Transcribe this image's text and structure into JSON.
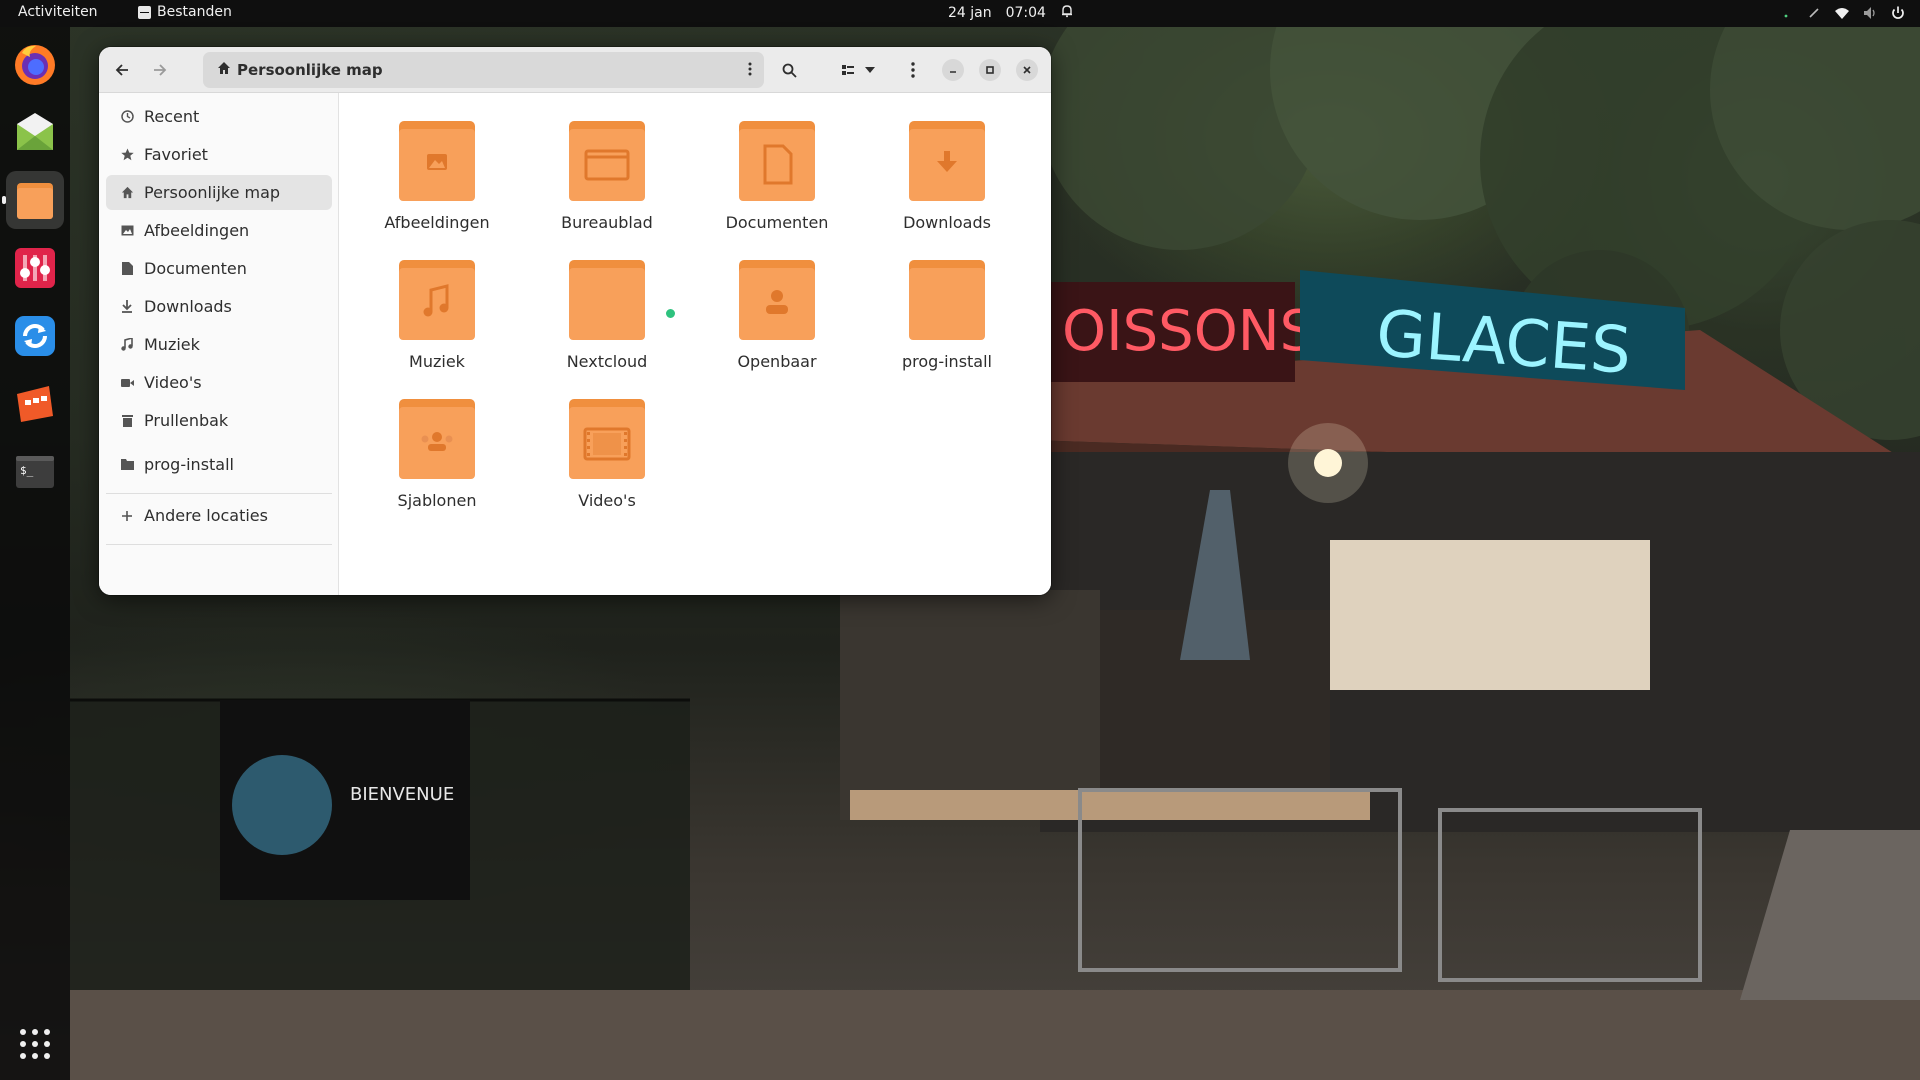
{
  "topbar": {
    "activities": "Activiteiten",
    "app_name": "Bestanden",
    "date": "24 jan",
    "time": "07:04"
  },
  "dock": {
    "items": [
      {
        "name": "firefox",
        "icon": "firefox-icon"
      },
      {
        "name": "mail",
        "icon": "mail-icon"
      },
      {
        "name": "files",
        "icon": "files-icon",
        "active": true
      },
      {
        "name": "mixer",
        "icon": "mixer-icon"
      },
      {
        "name": "sync",
        "icon": "sync-icon"
      },
      {
        "name": "media",
        "icon": "media-app-icon"
      },
      {
        "name": "terminal",
        "icon": "terminal-icon"
      },
      {
        "name": "app-grid",
        "icon": "app-grid-icon"
      }
    ]
  },
  "window": {
    "path": "Persoonlijke map"
  },
  "sidebar": {
    "items": [
      {
        "label": "Recent",
        "icon": "clock-icon"
      },
      {
        "label": "Favoriet",
        "icon": "star-icon"
      },
      {
        "label": "Persoonlijke map",
        "icon": "home-icon",
        "selected": true
      },
      {
        "label": "Afbeeldingen",
        "icon": "image-icon"
      },
      {
        "label": "Documenten",
        "icon": "document-icon"
      },
      {
        "label": "Downloads",
        "icon": "download-icon"
      },
      {
        "label": "Muziek",
        "icon": "music-icon"
      },
      {
        "label": "Video's",
        "icon": "video-icon"
      },
      {
        "label": "Prullenbak",
        "icon": "trash-icon"
      }
    ],
    "bookmarks": [
      {
        "label": "prog-install",
        "icon": "folder-icon"
      }
    ],
    "other_locations": {
      "label": "Andere locaties",
      "icon": "plus-icon"
    }
  },
  "folders": [
    {
      "label": "Afbeeldingen",
      "emblem": "image"
    },
    {
      "label": "Bureaublad",
      "emblem": "desktop"
    },
    {
      "label": "Documenten",
      "emblem": "document"
    },
    {
      "label": "Downloads",
      "emblem": "download"
    },
    {
      "label": "Muziek",
      "emblem": "music"
    },
    {
      "label": "Nextcloud",
      "emblem": "none",
      "sync_badge": true
    },
    {
      "label": "Openbaar",
      "emblem": "person"
    },
    {
      "label": "prog-install",
      "emblem": "none"
    },
    {
      "label": "Sjablonen",
      "emblem": "template"
    },
    {
      "label": "Video's",
      "emblem": "video"
    }
  ],
  "colors": {
    "folder": "#f8a05a",
    "folder_tab": "#f08f3e",
    "folder_emblem": "#e0782c",
    "selected": "#e4e4e4",
    "sync_badge": "#2ec27e"
  }
}
